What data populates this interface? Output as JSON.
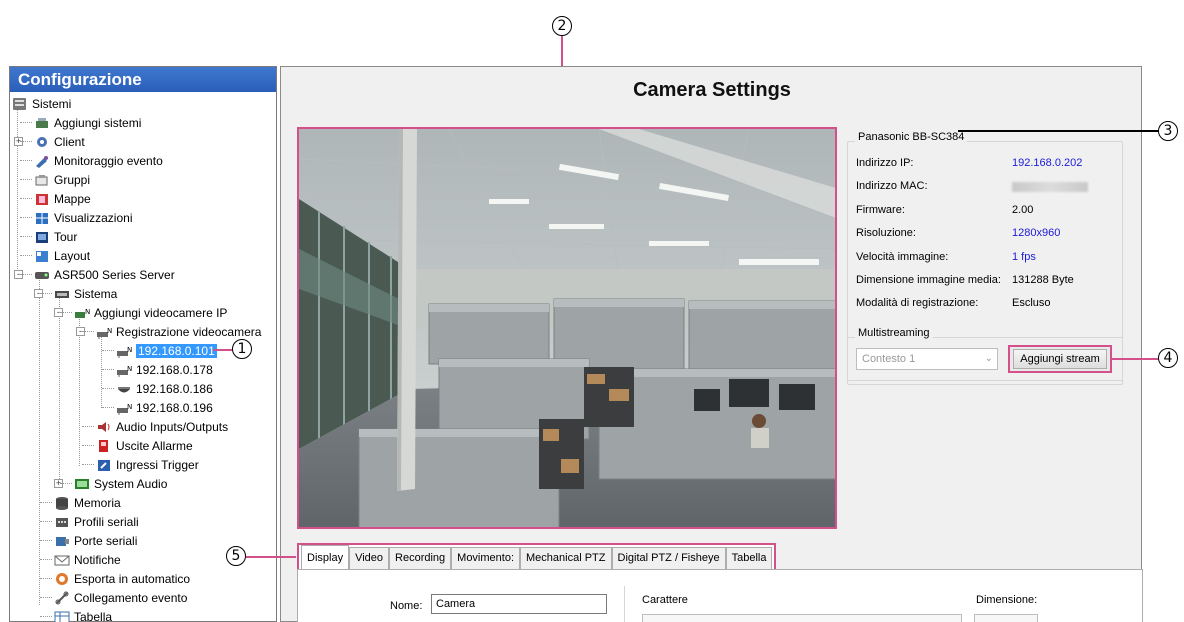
{
  "tree": {
    "header": "Configurazione",
    "items": [
      {
        "label": "Sistemi"
      },
      {
        "label": "Aggiungi sistemi"
      },
      {
        "label": "Client"
      },
      {
        "label": "Monitoraggio evento"
      },
      {
        "label": "Gruppi"
      },
      {
        "label": "Mappe"
      },
      {
        "label": "Visualizzazioni"
      },
      {
        "label": "Tour"
      },
      {
        "label": "Layout"
      },
      {
        "label": "ASR500 Series Server"
      },
      {
        "label": "Sistema"
      },
      {
        "label": "Aggiungi videocamere IP"
      },
      {
        "label": "Registrazione videocamera"
      },
      {
        "label": "192.168.0.101"
      },
      {
        "label": "192.168.0.178"
      },
      {
        "label": "192.168.0.186"
      },
      {
        "label": "192.168.0.196"
      },
      {
        "label": "Audio Inputs/Outputs"
      },
      {
        "label": "Uscite Allarme"
      },
      {
        "label": "Ingressi Trigger"
      },
      {
        "label": "System Audio"
      },
      {
        "label": "Memoria"
      },
      {
        "label": "Profili seriali"
      },
      {
        "label": "Porte seriali"
      },
      {
        "label": "Notifiche"
      },
      {
        "label": "Esporta in automatico"
      },
      {
        "label": "Collegamento evento"
      },
      {
        "label": "Tabella"
      }
    ]
  },
  "main": {
    "title": "Camera Settings"
  },
  "info": {
    "title": "Panasonic BB-SC384",
    "rows": [
      {
        "label": "Indirizzo IP:",
        "value": "192.168.0.202"
      },
      {
        "label": "Indirizzo MAC:",
        "value": ""
      },
      {
        "label": "Firmware:",
        "value": "2.00"
      },
      {
        "label": "Risoluzione:",
        "value": "1280x960"
      },
      {
        "label": "Velocità immagine:",
        "value": "1 fps"
      },
      {
        "label": "Dimensione immagine media:",
        "value": "131288 Byte"
      },
      {
        "label": "Modalità di registrazione:",
        "value": "Escluso"
      }
    ]
  },
  "multistreaming": {
    "title": "Multistreaming",
    "selected": "Contesto 1",
    "button": "Aggiungi stream"
  },
  "tabs": [
    "Display",
    "Video",
    "Recording",
    "Movimento:",
    "Mechanical PTZ",
    "Digital PTZ / Fisheye",
    "Tabella"
  ],
  "display_tab": {
    "name_label": "Nome:",
    "name_value": "Camera",
    "char_label": "Carattere",
    "dim_label": "Dimensione:"
  },
  "callouts": [
    "1",
    "2",
    "3",
    "4",
    "5"
  ],
  "colors": {
    "accent": "#d4508a",
    "header_blue": "#2a5fb9",
    "link_blue": "#1a1ad6",
    "selection": "#3399ff"
  }
}
